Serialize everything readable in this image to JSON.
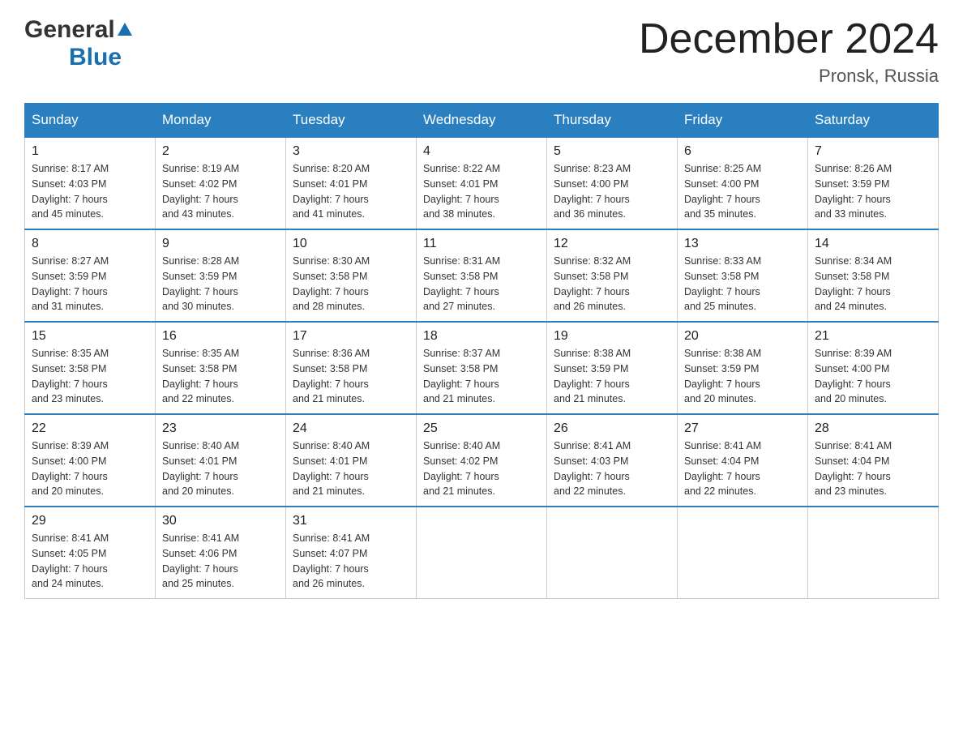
{
  "header": {
    "logo_general": "General",
    "logo_blue": "Blue",
    "month_title": "December 2024",
    "location": "Pronsk, Russia"
  },
  "days_of_week": [
    "Sunday",
    "Monday",
    "Tuesday",
    "Wednesday",
    "Thursday",
    "Friday",
    "Saturday"
  ],
  "weeks": [
    [
      {
        "day": "1",
        "sunrise": "8:17 AM",
        "sunset": "4:03 PM",
        "daylight": "7 hours and 45 minutes."
      },
      {
        "day": "2",
        "sunrise": "8:19 AM",
        "sunset": "4:02 PM",
        "daylight": "7 hours and 43 minutes."
      },
      {
        "day": "3",
        "sunrise": "8:20 AM",
        "sunset": "4:01 PM",
        "daylight": "7 hours and 41 minutes."
      },
      {
        "day": "4",
        "sunrise": "8:22 AM",
        "sunset": "4:01 PM",
        "daylight": "7 hours and 38 minutes."
      },
      {
        "day": "5",
        "sunrise": "8:23 AM",
        "sunset": "4:00 PM",
        "daylight": "7 hours and 36 minutes."
      },
      {
        "day": "6",
        "sunrise": "8:25 AM",
        "sunset": "4:00 PM",
        "daylight": "7 hours and 35 minutes."
      },
      {
        "day": "7",
        "sunrise": "8:26 AM",
        "sunset": "3:59 PM",
        "daylight": "7 hours and 33 minutes."
      }
    ],
    [
      {
        "day": "8",
        "sunrise": "8:27 AM",
        "sunset": "3:59 PM",
        "daylight": "7 hours and 31 minutes."
      },
      {
        "day": "9",
        "sunrise": "8:28 AM",
        "sunset": "3:59 PM",
        "daylight": "7 hours and 30 minutes."
      },
      {
        "day": "10",
        "sunrise": "8:30 AM",
        "sunset": "3:58 PM",
        "daylight": "7 hours and 28 minutes."
      },
      {
        "day": "11",
        "sunrise": "8:31 AM",
        "sunset": "3:58 PM",
        "daylight": "7 hours and 27 minutes."
      },
      {
        "day": "12",
        "sunrise": "8:32 AM",
        "sunset": "3:58 PM",
        "daylight": "7 hours and 26 minutes."
      },
      {
        "day": "13",
        "sunrise": "8:33 AM",
        "sunset": "3:58 PM",
        "daylight": "7 hours and 25 minutes."
      },
      {
        "day": "14",
        "sunrise": "8:34 AM",
        "sunset": "3:58 PM",
        "daylight": "7 hours and 24 minutes."
      }
    ],
    [
      {
        "day": "15",
        "sunrise": "8:35 AM",
        "sunset": "3:58 PM",
        "daylight": "7 hours and 23 minutes."
      },
      {
        "day": "16",
        "sunrise": "8:35 AM",
        "sunset": "3:58 PM",
        "daylight": "7 hours and 22 minutes."
      },
      {
        "day": "17",
        "sunrise": "8:36 AM",
        "sunset": "3:58 PM",
        "daylight": "7 hours and 21 minutes."
      },
      {
        "day": "18",
        "sunrise": "8:37 AM",
        "sunset": "3:58 PM",
        "daylight": "7 hours and 21 minutes."
      },
      {
        "day": "19",
        "sunrise": "8:38 AM",
        "sunset": "3:59 PM",
        "daylight": "7 hours and 21 minutes."
      },
      {
        "day": "20",
        "sunrise": "8:38 AM",
        "sunset": "3:59 PM",
        "daylight": "7 hours and 20 minutes."
      },
      {
        "day": "21",
        "sunrise": "8:39 AM",
        "sunset": "4:00 PM",
        "daylight": "7 hours and 20 minutes."
      }
    ],
    [
      {
        "day": "22",
        "sunrise": "8:39 AM",
        "sunset": "4:00 PM",
        "daylight": "7 hours and 20 minutes."
      },
      {
        "day": "23",
        "sunrise": "8:40 AM",
        "sunset": "4:01 PM",
        "daylight": "7 hours and 20 minutes."
      },
      {
        "day": "24",
        "sunrise": "8:40 AM",
        "sunset": "4:01 PM",
        "daylight": "7 hours and 21 minutes."
      },
      {
        "day": "25",
        "sunrise": "8:40 AM",
        "sunset": "4:02 PM",
        "daylight": "7 hours and 21 minutes."
      },
      {
        "day": "26",
        "sunrise": "8:41 AM",
        "sunset": "4:03 PM",
        "daylight": "7 hours and 22 minutes."
      },
      {
        "day": "27",
        "sunrise": "8:41 AM",
        "sunset": "4:04 PM",
        "daylight": "7 hours and 22 minutes."
      },
      {
        "day": "28",
        "sunrise": "8:41 AM",
        "sunset": "4:04 PM",
        "daylight": "7 hours and 23 minutes."
      }
    ],
    [
      {
        "day": "29",
        "sunrise": "8:41 AM",
        "sunset": "4:05 PM",
        "daylight": "7 hours and 24 minutes."
      },
      {
        "day": "30",
        "sunrise": "8:41 AM",
        "sunset": "4:06 PM",
        "daylight": "7 hours and 25 minutes."
      },
      {
        "day": "31",
        "sunrise": "8:41 AM",
        "sunset": "4:07 PM",
        "daylight": "7 hours and 26 minutes."
      },
      null,
      null,
      null,
      null
    ]
  ],
  "labels": {
    "sunrise": "Sunrise:",
    "sunset": "Sunset:",
    "daylight": "Daylight:"
  }
}
